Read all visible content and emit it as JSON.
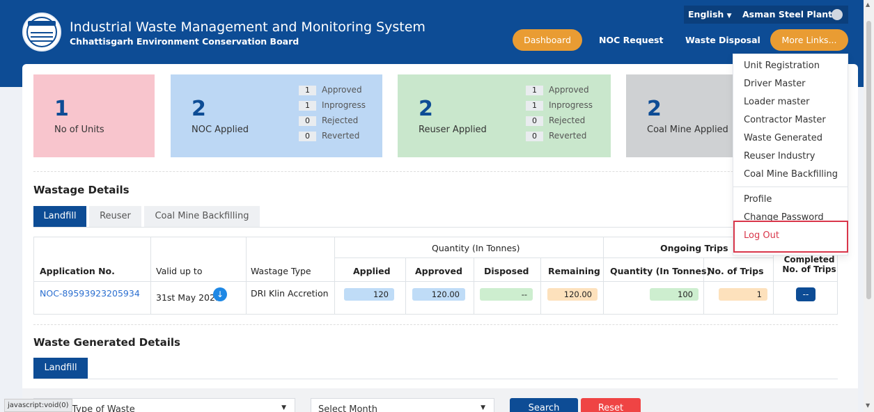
{
  "header": {
    "title": "Industrial Waste Management and Monitoring System",
    "subtitle": "Chhattisgarh Environment Conservation Board",
    "language": "English",
    "user": "Asman Steel Plant",
    "nav": {
      "dashboard": "Dashboard",
      "noc_request": "NOC Request",
      "waste_disposal": "Waste Disposal",
      "more_links": "More Links..."
    }
  },
  "stats": {
    "units": {
      "value": "1",
      "label": "No of Units"
    },
    "noc": {
      "value": "2",
      "label": "NOC Applied",
      "breakdown": [
        {
          "n": "1",
          "label": "Approved"
        },
        {
          "n": "1",
          "label": "Inprogress"
        },
        {
          "n": "0",
          "label": "Rejected"
        },
        {
          "n": "0",
          "label": "Reverted"
        }
      ]
    },
    "reuser": {
      "value": "2",
      "label": "Reuser Applied",
      "breakdown": [
        {
          "n": "1",
          "label": "Approved"
        },
        {
          "n": "1",
          "label": "Inprogress"
        },
        {
          "n": "0",
          "label": "Rejected"
        },
        {
          "n": "0",
          "label": "Reverted"
        }
      ]
    },
    "coal": {
      "value": "2",
      "label": "Coal Mine Applied"
    }
  },
  "wastage": {
    "title": "Wastage Details",
    "tabs": [
      "Landfill",
      "Reuser",
      "Coal Mine Backfilling"
    ],
    "group_quantity": "Quantity (In Tonnes)",
    "group_trips": "Ongoing Trips",
    "columns": [
      "Application No.",
      "Valid up to",
      "Wastage Type",
      "Applied",
      "Approved",
      "Disposed",
      "Remaining",
      "Quantity (In Tonnes)",
      "No. of Trips",
      "Completed No. of Trips"
    ],
    "row": {
      "app_no": "NOC-89593923205934",
      "valid_upto": "31st May 2025",
      "type": "DRI Klin Accretion",
      "applied": "120",
      "approved": "120.00",
      "disposed": "--",
      "remaining": "120.00",
      "trip_qty": "100",
      "trips": "1",
      "completed": "--"
    }
  },
  "waste_generated": {
    "title": "Waste Generated Details",
    "tab": "Landfill"
  },
  "filters": {
    "type": "Select Type of Waste",
    "month": "Select Month",
    "search": "Search",
    "reset": "Reset"
  },
  "dropdown": [
    "Unit Registration",
    "Driver Master",
    "Loader master",
    "Contractor Master",
    "Waste Generated",
    "Reuser Industry",
    "Coal Mine Backfilling",
    "Profile",
    "Change Password",
    "Log Out"
  ],
  "status_bar": "javascript:void(0)",
  "colors": {
    "primary": "#0d4c95",
    "accent": "#e99c33",
    "reset": "#ef4444",
    "logout_border": "#d9364a"
  }
}
